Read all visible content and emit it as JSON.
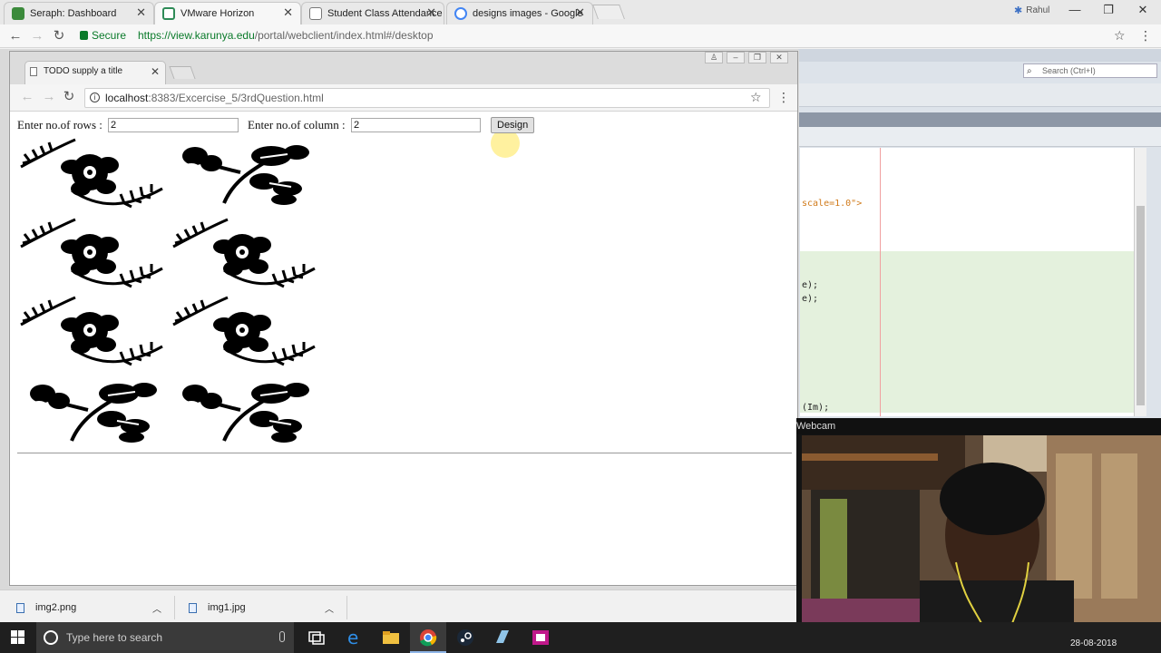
{
  "outer_browser": {
    "tabs": [
      {
        "label": "Seraph: Dashboard",
        "icon": "seraph-icon"
      },
      {
        "label": "VMware Horizon",
        "icon": "vmware-icon"
      },
      {
        "label": "Student Class Attendance",
        "icon": "page-icon"
      },
      {
        "label": "designs images - Google",
        "icon": "google-icon"
      }
    ],
    "user": "Rahul",
    "secure_label": "Secure",
    "url_host": "https://view.karunya.edu",
    "url_path": "/portal/webclient/index.html#/desktop"
  },
  "inner_browser": {
    "tab_title": "TODO supply a title",
    "url_host": "localhost",
    "url_path": ":8383/Excercise_5/3rdQuestion.html"
  },
  "form": {
    "rows_label": "Enter no.of rows :",
    "rows_value": "2",
    "cols_label": "Enter no.of column :",
    "cols_value": "2",
    "design_button": "Design"
  },
  "ide": {
    "search_placeholder": "Search (Ctrl+I)",
    "code_line_1": "scale=1.0\">",
    "code_line_2": "e);",
    "code_line_3": "e);",
    "code_line_4": "(Im);"
  },
  "webcam": {
    "title": "Webcam"
  },
  "downloads": [
    {
      "name": "img2.png"
    },
    {
      "name": "img1.jpg"
    }
  ],
  "taskbar": {
    "search_placeholder": "Type here to search",
    "date": "28-08-2018"
  },
  "colors": {
    "secure_green": "#0a7a2a",
    "taskbar_bg": "#1f1f1f",
    "ide_green": "#e4f1dd"
  }
}
